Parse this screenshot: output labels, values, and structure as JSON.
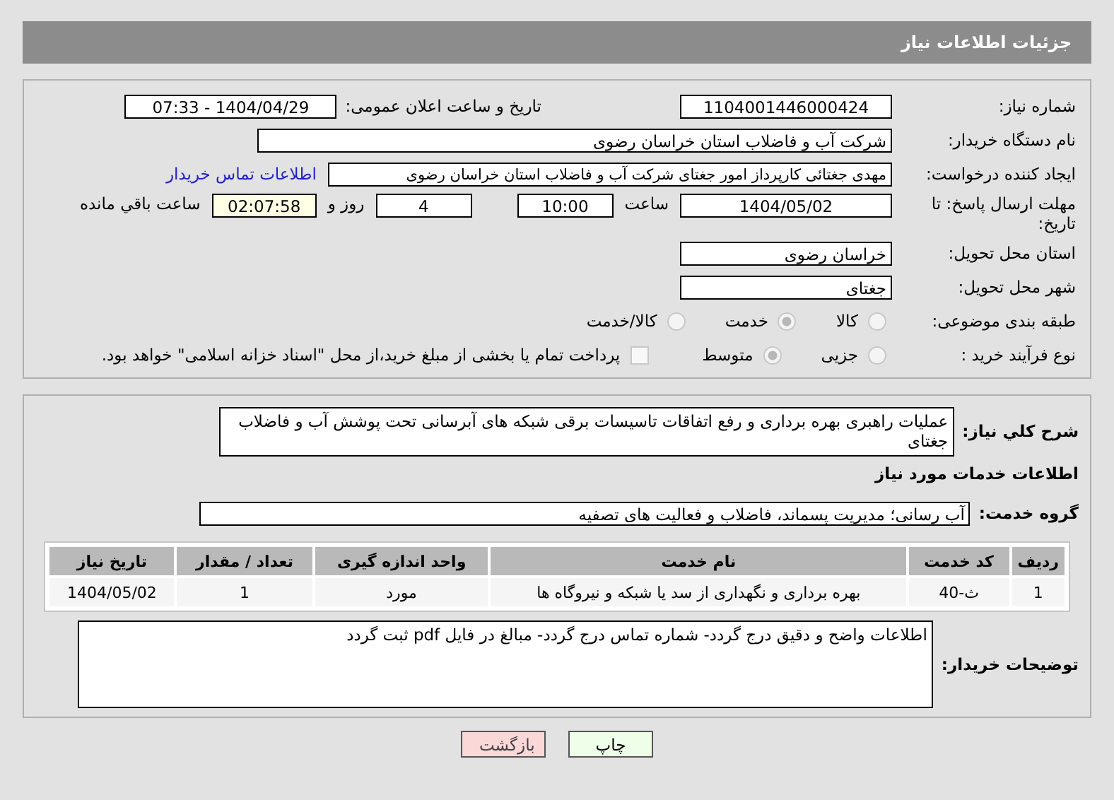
{
  "header": {
    "title": "جزئیات اطلاعات نیاز"
  },
  "need_number": {
    "label": "شماره نیاز:",
    "value": "1104001446000424"
  },
  "announce": {
    "label": "تاریخ و ساعت اعلان عمومی:",
    "value": "1404/04/29 - 07:33"
  },
  "buyer_org": {
    "label": "نام دستگاه خریدار:",
    "value": "شرکت آب و فاضلاب استان خراسان رضوی"
  },
  "creator": {
    "label": "ایجاد کننده درخواست:",
    "value": "مهدی جغتائی کارپرداز امور جغتای  شرکت آب و فاضلاب استان خراسان رضوی",
    "link": "اطلاعات تماس خریدار"
  },
  "deadline": {
    "label": "مهلت ارسال پاسخ: تا تاریخ:",
    "date": "1404/05/02",
    "time_label": "ساعت",
    "time": "10:00",
    "days": "4",
    "days_label": "روز و",
    "remaining": "02:07:58",
    "remaining_label": "ساعت باقي مانده"
  },
  "province": {
    "label": "استان محل تحویل:",
    "value": "خراسان رضوی"
  },
  "city": {
    "label": "شهر محل تحویل:",
    "value": "جغتای"
  },
  "category": {
    "label": "طبقه بندی موضوعی:",
    "options": [
      {
        "label": "کالا",
        "selected": false
      },
      {
        "label": "خدمت",
        "selected": true
      },
      {
        "label": "کالا/خدمت",
        "selected": false
      }
    ]
  },
  "process": {
    "label": "نوع فرآیند خرید :",
    "options": [
      {
        "label": "جزیی",
        "selected": false
      },
      {
        "label": "متوسط",
        "selected": true
      }
    ],
    "payment": {
      "checked": false,
      "text": "پرداخت تمام یا بخشی از مبلغ خرید،از محل \"اسناد خزانه اسلامی\" خواهد بود."
    }
  },
  "description": {
    "label": "شرح کلي نياز:",
    "value": "عملیات  راهبری بهره برداری و رفع اتفاقات  تاسیسات برقی شبکه های آبرسانی تحت  پوشش آب و فاضلاب جغتای"
  },
  "services_heading": "اطلاعات خدمات مورد نیاز",
  "service_group": {
    "label": "گروه خدمت:",
    "value": "آب رسانی؛ مدیریت پسماند، فاضلاب و فعالیت های تصفیه"
  },
  "table": {
    "columns": [
      "ردیف",
      "کد خدمت",
      "نام خدمت",
      "واحد اندازه گیری",
      "تعداد / مقدار",
      "تاریخ نیاز"
    ],
    "rows": [
      [
        "1",
        "ث-40",
        "بهره برداری و نگهداری از سد یا شبکه و نیروگاه ها",
        "مورد",
        "1",
        "1404/05/02"
      ]
    ]
  },
  "buyer_notes": {
    "label": "توضیحات خریدار:",
    "value": "اطلاعات واضح و دقیق درج گردد- شماره تماس درج گردد- مبالغ در فایل pdf ثبت گردد"
  },
  "buttons": [
    {
      "kind": "print",
      "label": "چاپ"
    },
    {
      "kind": "back",
      "label": "بازگشت"
    }
  ]
}
